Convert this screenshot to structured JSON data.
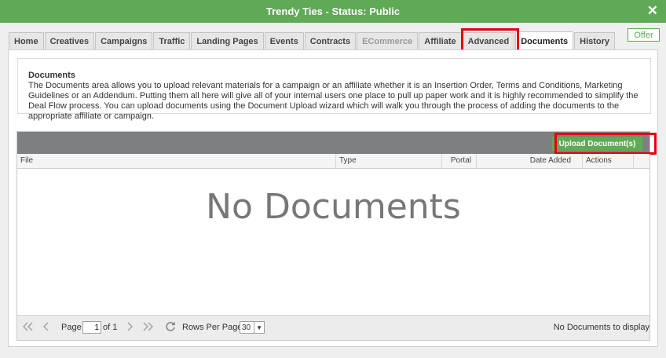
{
  "window": {
    "title": "Trendy Ties - Status: Public",
    "close_glyph": "✕"
  },
  "offer_badge": "Offer",
  "tabs": [
    {
      "label": "Home",
      "state": "normal"
    },
    {
      "label": "Creatives",
      "state": "normal"
    },
    {
      "label": "Campaigns",
      "state": "normal"
    },
    {
      "label": "Traffic",
      "state": "normal"
    },
    {
      "label": "Landing Pages",
      "state": "normal"
    },
    {
      "label": "Events",
      "state": "normal"
    },
    {
      "label": "Contracts",
      "state": "normal"
    },
    {
      "label": "ECommerce",
      "state": "disabled"
    },
    {
      "label": "Affiliate",
      "state": "normal"
    },
    {
      "label": "Advanced",
      "state": "normal"
    },
    {
      "label": "Documents",
      "state": "active"
    },
    {
      "label": "History",
      "state": "normal"
    }
  ],
  "description": {
    "title": "Documents",
    "body": "The Documents area allows you to upload relevant materials for a campaign or an affiliate whether it is an Insertion Order, Terms and Conditions, Marketing Guidelines or an Addendum. Putting them all here will give all of your internal users one place to pull up paper work and it is highly recommended to simplify the Deal Flow process. You can upload documents using the Document Upload wizard which will walk you through the process of adding the documents to the appropriate affiliate or campaign."
  },
  "grid": {
    "upload_button": "Upload Document(s)",
    "columns": {
      "file": "File",
      "type": "Type",
      "portal": "Portal",
      "date_added": "Date Added",
      "actions": "Actions"
    },
    "empty_message": "No Documents",
    "pager": {
      "page_label": "Page",
      "page_value": "1",
      "of_label": "of 1",
      "rows_label": "Rows Per Page:",
      "rows_value": "30",
      "status": "No Documents to display"
    }
  },
  "colors": {
    "brand_green": "#5fa957",
    "highlight_red": "#e3000f",
    "toolbar_gray": "#7d7f80"
  },
  "icons": {
    "first_page": "double-chevron-left-icon",
    "prev_page": "chevron-left-icon",
    "next_page": "chevron-right-icon",
    "last_page": "double-chevron-right-icon",
    "refresh": "refresh-icon",
    "dropdown": "caret-down-icon"
  }
}
